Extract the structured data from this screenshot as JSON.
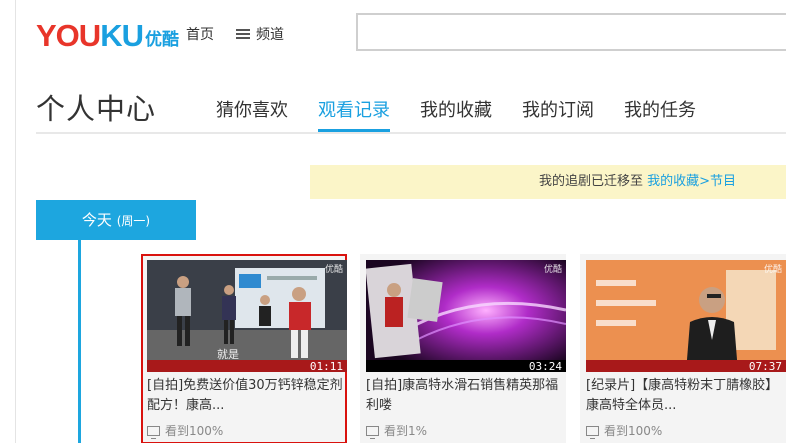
{
  "header": {
    "logo_latin_a": "YOU",
    "logo_latin_b": "KU",
    "logo_cn": "优酷",
    "nav_home": "首页",
    "nav_channel": "频道",
    "search_placeholder": ""
  },
  "page": {
    "title": "个人中心",
    "tabs": [
      {
        "label": "猜你喜欢",
        "active": false
      },
      {
        "label": "观看记录",
        "active": true
      },
      {
        "label": "我的收藏",
        "active": false
      },
      {
        "label": "我的订阅",
        "active": false
      },
      {
        "label": "我的任务",
        "active": false
      }
    ]
  },
  "notice": {
    "text": "我的追剧已迁移至 ",
    "link": "我的收藏>节目"
  },
  "timeline": {
    "day": "今天",
    "weekday": "(周一)"
  },
  "videos": [
    {
      "title": "[自拍]免费送价值30万钙锌稳定剂配方！康高...",
      "duration": "01:11",
      "watermark": "优酷",
      "progress": "看到100%",
      "selected": true
    },
    {
      "title": "[自拍]康高特水滑石销售精英那福利喽",
      "duration": "03:24",
      "watermark": "优酷",
      "progress": "看到1%",
      "selected": false
    },
    {
      "title": "[纪录片]【康高特粉末丁腈橡胶】康高特全体员...",
      "duration": "07:37",
      "watermark": "优酷",
      "progress": "看到100%",
      "selected": false
    }
  ],
  "colors": {
    "accent": "#1aa0e0",
    "logo_red": "#e8352a",
    "selected_border": "#d9120e",
    "duration_bar": "#a8191a",
    "notice_bg": "#fbf5c8"
  }
}
